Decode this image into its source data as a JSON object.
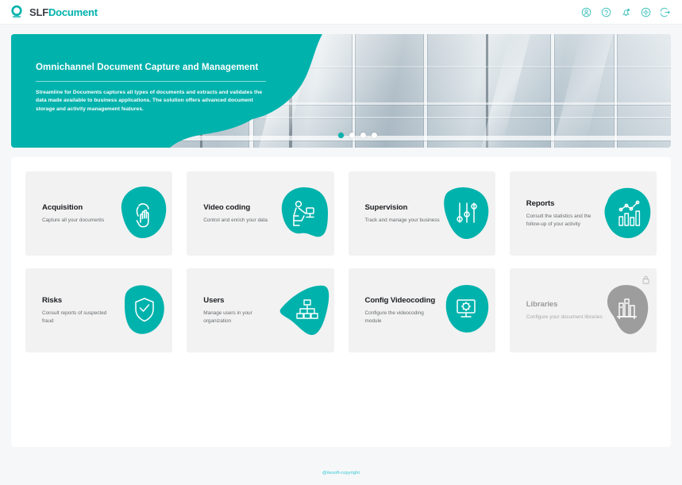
{
  "header": {
    "brand_primary": "SLF",
    "brand_secondary": "Document",
    "logo_icon": "circle-ring-logo-icon",
    "actions": [
      {
        "name": "account-icon",
        "label": "Account"
      },
      {
        "name": "help-idea-icon",
        "label": "Help"
      },
      {
        "name": "notification-bell-icon",
        "label": "Notifications"
      },
      {
        "name": "settings-gear-icon",
        "label": "Settings"
      },
      {
        "name": "logout-icon",
        "label": "Log out"
      }
    ]
  },
  "hero": {
    "title": "Omnichannel Document Capture and Management",
    "description": "Streamline for Documents captures all types of documents and extracts and validates the data made available to business applications. The solution offers advanced document storage and activity management features.",
    "carousel": {
      "total": 4,
      "active_index": 0
    }
  },
  "cards": [
    {
      "title": "Acquisition",
      "subtitle": "Capture all your documents",
      "icon": "hand-scan-icon",
      "locked": false
    },
    {
      "title": "Video coding",
      "subtitle": "Control and enrich your data",
      "icon": "person-at-desk-icon",
      "locked": false
    },
    {
      "title": "Supervision",
      "subtitle": "Track and manage your business",
      "icon": "sliders-icon",
      "locked": false
    },
    {
      "title": "Reports",
      "subtitle": "Consult the statistics and the follow-up of your activity",
      "icon": "bar-chart-line-icon",
      "locked": false
    },
    {
      "title": "Risks",
      "subtitle": "Consult reports of suspected fraud",
      "icon": "shield-check-icon",
      "locked": false
    },
    {
      "title": "Users",
      "subtitle": "Manage users in your organization",
      "icon": "org-chart-icon",
      "locked": false
    },
    {
      "title": "Config Videocoding",
      "subtitle": "Configure the videocoding module",
      "icon": "monitor-gear-icon",
      "locked": false
    },
    {
      "title": "Libraries",
      "subtitle": "Configure your document libraries",
      "icon": "books-shelf-icon",
      "locked": true,
      "lock_icon": "padlock-icon"
    }
  ],
  "footer": {
    "copyright": "@itesoft-copyright"
  },
  "colors": {
    "accent_teal": "#00b2ac",
    "accent_teal_dark": "#009a96",
    "locked_gray": "#9b9b9b",
    "page_bg": "#f6f7f9",
    "card_bg": "#f2f2f2",
    "footer_link": "#31c8d4"
  }
}
